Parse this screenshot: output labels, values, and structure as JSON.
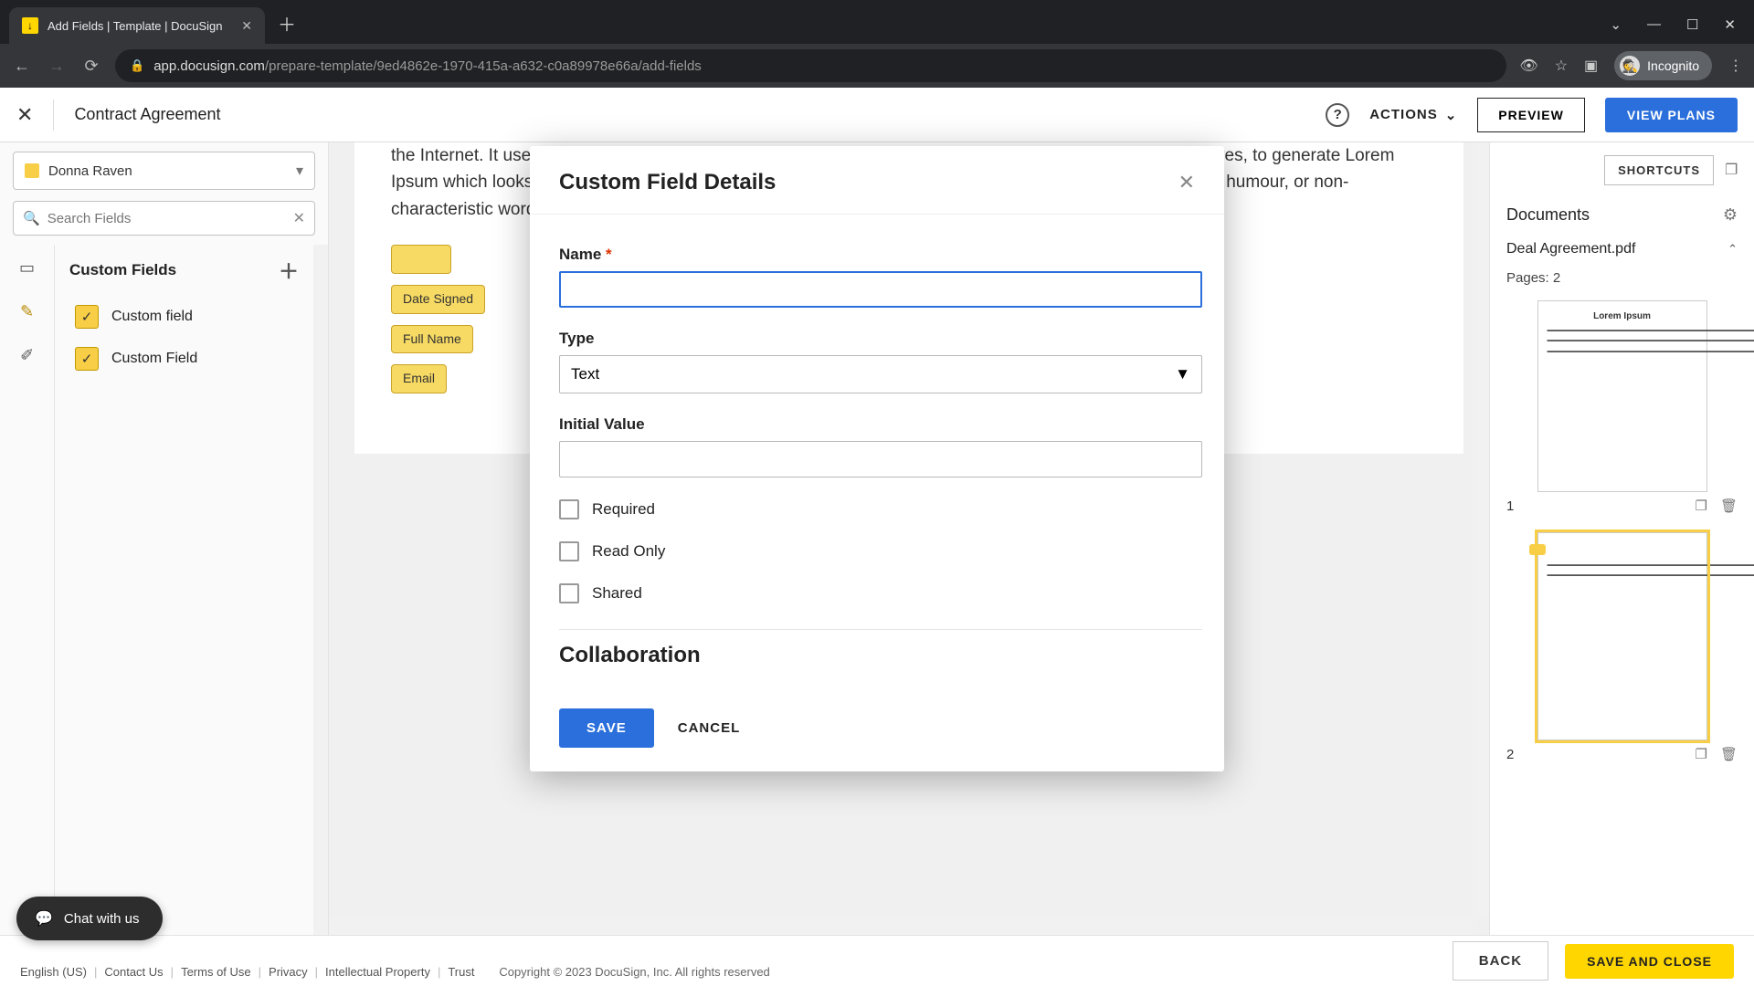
{
  "browser": {
    "tab_title": "Add Fields | Template | DocuSign",
    "url_host": "app.docusign.com",
    "url_path": "/prepare-template/9ed4862e-1970-415a-a632-c0a89978e66a/add-fields",
    "profile_label": "Incognito"
  },
  "topbar": {
    "doc_title": "Contract Agreement",
    "actions_label": "ACTIONS",
    "preview_label": "PREVIEW",
    "view_plans_label": "VIEW PLANS"
  },
  "left": {
    "recipient_name": "Donna Raven",
    "search_placeholder": "Search Fields",
    "custom_fields_header": "Custom Fields",
    "fields": [
      {
        "label": "Custom field"
      },
      {
        "label": "Custom Field"
      }
    ]
  },
  "canvas": {
    "body_text": "the Internet. It uses a dictionary of over 200 Latin words, combined with a handful of model sentence structures, to generate Lorem Ipsum which looks reasonable. The generated Lorem Ipsum is therefore always free from repetition, injected humour, or non-characteristic words etc.",
    "placed": [
      {
        "label": "Date Signed"
      },
      {
        "label": "Full Name"
      },
      {
        "label": "Email"
      }
    ]
  },
  "right": {
    "shortcuts_label": "SHORTCUTS",
    "documents_header": "Documents",
    "doc_name": "Deal Agreement.pdf",
    "pages_label": "Pages: 2",
    "thumbs": [
      {
        "page": "1",
        "title": "Lorem Ipsum"
      },
      {
        "page": "2",
        "title": ""
      }
    ]
  },
  "bottom": {
    "back_label": "BACK",
    "save_close_label": "SAVE AND CLOSE"
  },
  "footer": {
    "lang": "English (US)",
    "links": [
      "Contact Us",
      "Terms of Use",
      "Privacy",
      "Intellectual Property",
      "Trust"
    ],
    "copyright": "Copyright © 2023 DocuSign, Inc. All rights reserved"
  },
  "chat": {
    "label": "Chat with us"
  },
  "modal": {
    "title": "Custom Field Details",
    "name_label": "Name",
    "name_value": "",
    "type_label": "Type",
    "type_value": "Text",
    "initial_value_label": "Initial Value",
    "initial_value": "",
    "required_label": "Required",
    "readonly_label": "Read Only",
    "shared_label": "Shared",
    "collaboration_header": "Collaboration",
    "save_label": "SAVE",
    "cancel_label": "CANCEL"
  }
}
